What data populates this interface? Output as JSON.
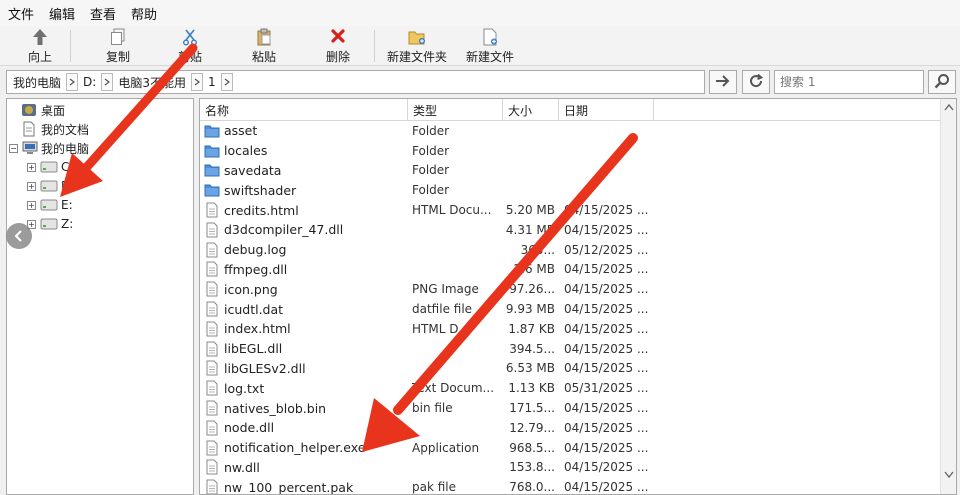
{
  "menu": [
    "文件",
    "编辑",
    "查看",
    "帮助"
  ],
  "toolbar": {
    "up": "向上",
    "copy": "复制",
    "cut": "剪贴",
    "paste": "粘贴",
    "delete": "删除",
    "new_folder": "新建文件夹",
    "new_file": "新建文件"
  },
  "address": {
    "crumbs": [
      "我的电脑",
      "D:",
      "电脑3不能用",
      "1"
    ]
  },
  "search": {
    "placeholder": "搜索 1"
  },
  "tree": {
    "desktop": "桌面",
    "documents": "我的文档",
    "computer": "我的电脑",
    "drives": [
      "C:",
      "D:",
      "E:",
      "Z:"
    ],
    "expand_sign": "+",
    "collapse_sign": "−"
  },
  "columns": {
    "name": "名称",
    "type": "类型",
    "size": "大小",
    "date": "日期"
  },
  "files": [
    {
      "name": "asset",
      "type": "Folder",
      "size": "",
      "date": "",
      "kind": "folder"
    },
    {
      "name": "locales",
      "type": "Folder",
      "size": "",
      "date": "",
      "kind": "folder"
    },
    {
      "name": "savedata",
      "type": "Folder",
      "size": "",
      "date": "",
      "kind": "folder"
    },
    {
      "name": "swiftshader",
      "type": "Folder",
      "size": "",
      "date": "",
      "kind": "folder"
    },
    {
      "name": "credits.html",
      "type": "HTML Docu...",
      "size": "5.20 MB",
      "date": "04/15/2025 ...",
      "kind": "file"
    },
    {
      "name": "d3dcompiler_47.dll",
      "type": "",
      "size": "4.31 MB",
      "date": "04/15/2025 ...",
      "kind": "file"
    },
    {
      "name": "debug.log",
      "type": "",
      "size": "365...",
      "date": "05/12/2025 ...",
      "kind": "file"
    },
    {
      "name": "ffmpeg.dll",
      "type": "",
      "size": "2.6 MB",
      "date": "04/15/2025 ...",
      "kind": "file"
    },
    {
      "name": "icon.png",
      "type": "PNG Image",
      "size": "97.26...",
      "date": "04/15/2025 ...",
      "kind": "file"
    },
    {
      "name": "icudtl.dat",
      "type": "datfile file",
      "size": "9.93 MB",
      "date": "04/15/2025 ...",
      "kind": "file"
    },
    {
      "name": "index.html",
      "type": "HTML D...",
      "size": "1.87 KB",
      "date": "04/15/2025 ...",
      "kind": "file"
    },
    {
      "name": "libEGL.dll",
      "type": "",
      "size": "394.5...",
      "date": "04/15/2025 ...",
      "kind": "file"
    },
    {
      "name": "libGLESv2.dll",
      "type": "",
      "size": "6.53 MB",
      "date": "04/15/2025 ...",
      "kind": "file"
    },
    {
      "name": "log.txt",
      "type": "Text Docum...",
      "size": "1.13 KB",
      "date": "05/31/2025 ...",
      "kind": "file"
    },
    {
      "name": "natives_blob.bin",
      "type": "bin file",
      "size": "171.5...",
      "date": "04/15/2025 ...",
      "kind": "file"
    },
    {
      "name": "node.dll",
      "type": "",
      "size": "12.79...",
      "date": "04/15/2025 ...",
      "kind": "file"
    },
    {
      "name": "notification_helper.exe",
      "type": "Application",
      "size": "968.5...",
      "date": "04/15/2025 ...",
      "kind": "file"
    },
    {
      "name": "nw.dll",
      "type": "",
      "size": "153.8...",
      "date": "04/15/2025 ...",
      "kind": "file"
    },
    {
      "name": "nw_100_percent.pak",
      "type": "pak file",
      "size": "768.0...",
      "date": "04/15/2025 ...",
      "kind": "file"
    }
  ],
  "colors": {
    "arrow": "#e8341c",
    "folder": "#4f8fd6",
    "delete": "#d8201a",
    "up_arrow": "#6f6f6f"
  }
}
